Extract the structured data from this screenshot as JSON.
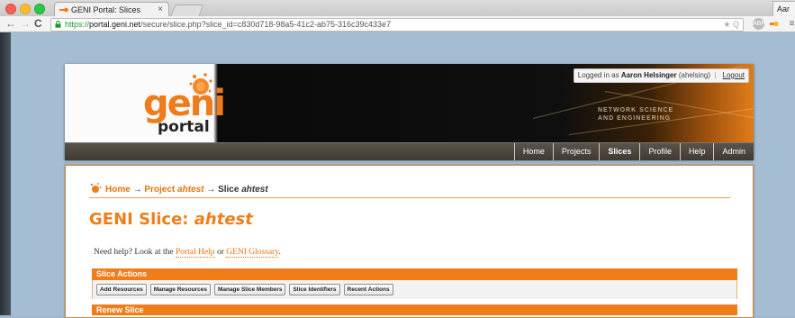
{
  "browser": {
    "tab_title": "GENI Portal: Slices",
    "tab_close": "×",
    "user_chip": "Aar",
    "url_scheme": "https://",
    "url_host": "portal.geni.net",
    "url_path": "/secure/slice.php?slice_id=c830d718-98a5-41c2-ab75-316c39c433e7",
    "omni_icons": "★ Q",
    "ext_abp": "ABP"
  },
  "header": {
    "logo_word": "geni",
    "logo_sub": "portal",
    "login_prefix": "Logged in as ",
    "login_user": "Aaron Helsinger",
    "login_suffix": " (ahelsing)",
    "login_sep": "|",
    "logout": "Logout",
    "tagline_1": "NETWORK SCIENCE",
    "tagline_2": "AND ENGINEERING",
    "nav": {
      "home": "Home",
      "projects": "Projects",
      "slices": "Slices",
      "profile": "Profile",
      "help": "Help",
      "admin": "Admin"
    }
  },
  "content": {
    "crumb_home": "Home",
    "crumb_arrow1": " → ",
    "crumb_project_prefix": "Project ",
    "crumb_project": "ahtest",
    "crumb_arrow2": " → ",
    "crumb_slice_prefix": "Slice ",
    "crumb_slice": "ahtest",
    "title_prefix": "GENI Slice: ",
    "title_slice": "ahtest",
    "help_prefix": "Need help? Look at the ",
    "help_link1": "Portal Help",
    "help_mid": " or ",
    "help_link2": "GENI Glossary",
    "help_suffix": ".",
    "slice_actions": "Slice Actions",
    "renew_slice": "Renew Slice",
    "buttons": {
      "add_resources": "Add Resources",
      "manage_resources": "Manage Resources",
      "manage_members": "Manage Slice Members",
      "identifiers": "Slice Identifiers",
      "recent_actions": "Recent Actions"
    }
  },
  "colors": {
    "accent": "#f07d1a",
    "navbar": "#4a443c"
  }
}
